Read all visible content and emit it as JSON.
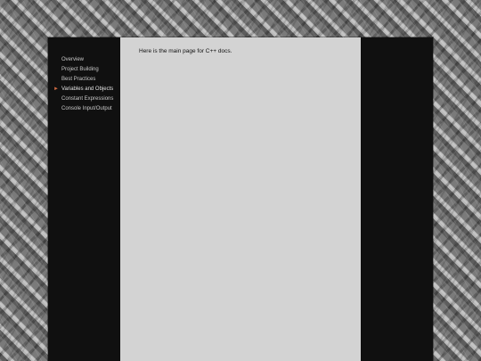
{
  "sidebar": {
    "items": [
      {
        "label": "Overview",
        "active": false
      },
      {
        "label": "Project Building",
        "active": false
      },
      {
        "label": "Best Practices",
        "active": false
      },
      {
        "label": "Variables and Objects",
        "active": true
      },
      {
        "label": "Constant Expressions",
        "active": false
      },
      {
        "label": "Console Input/Output",
        "active": false
      }
    ]
  },
  "main": {
    "text": "Here is the main page for C++ docs."
  },
  "icons": {
    "current_item": "play-arrow-icon"
  },
  "colors": {
    "accent": "#cf6a43",
    "panel": "#101010",
    "content": "#d3d3d3"
  }
}
